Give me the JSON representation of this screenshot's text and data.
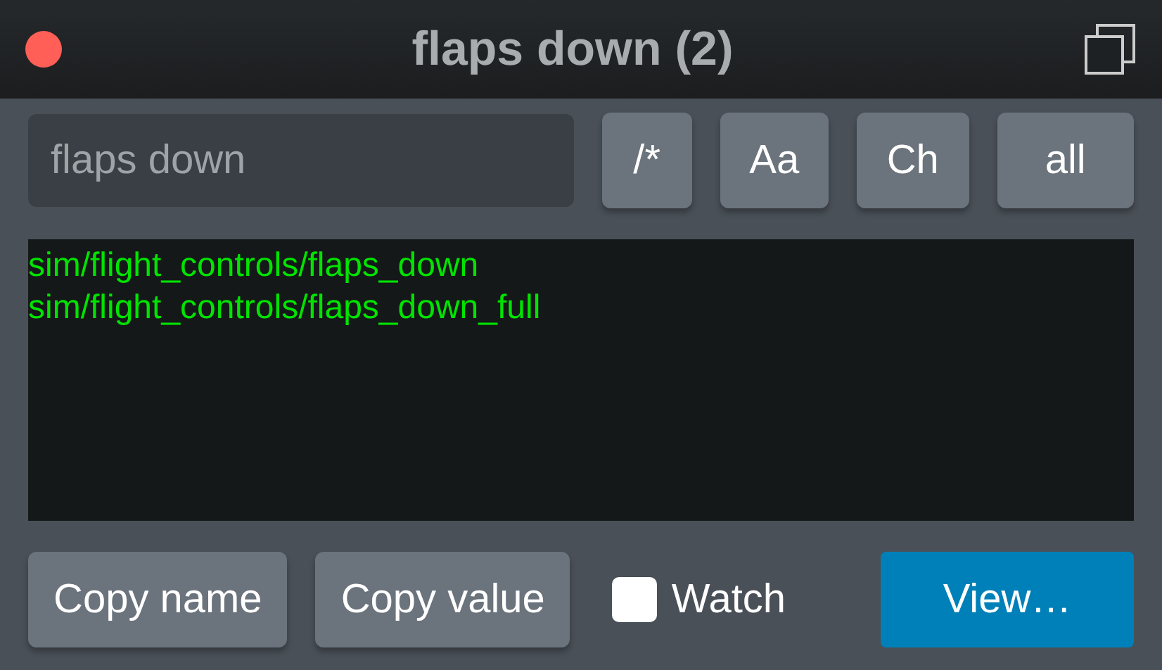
{
  "window": {
    "title": "flaps down (2)"
  },
  "search": {
    "value": "flaps down"
  },
  "toggles": [
    {
      "label": "/*"
    },
    {
      "label": "Aa"
    },
    {
      "label": "Ch"
    },
    {
      "label": "all"
    }
  ],
  "results": [
    "sim/flight_controls/flaps_down",
    "sim/flight_controls/flaps_down_full"
  ],
  "actions": [
    {
      "label": "Copy name"
    },
    {
      "label": "Copy value"
    }
  ],
  "watch": {
    "label": "Watch",
    "checked": false
  },
  "view_button": {
    "label": "View…"
  }
}
